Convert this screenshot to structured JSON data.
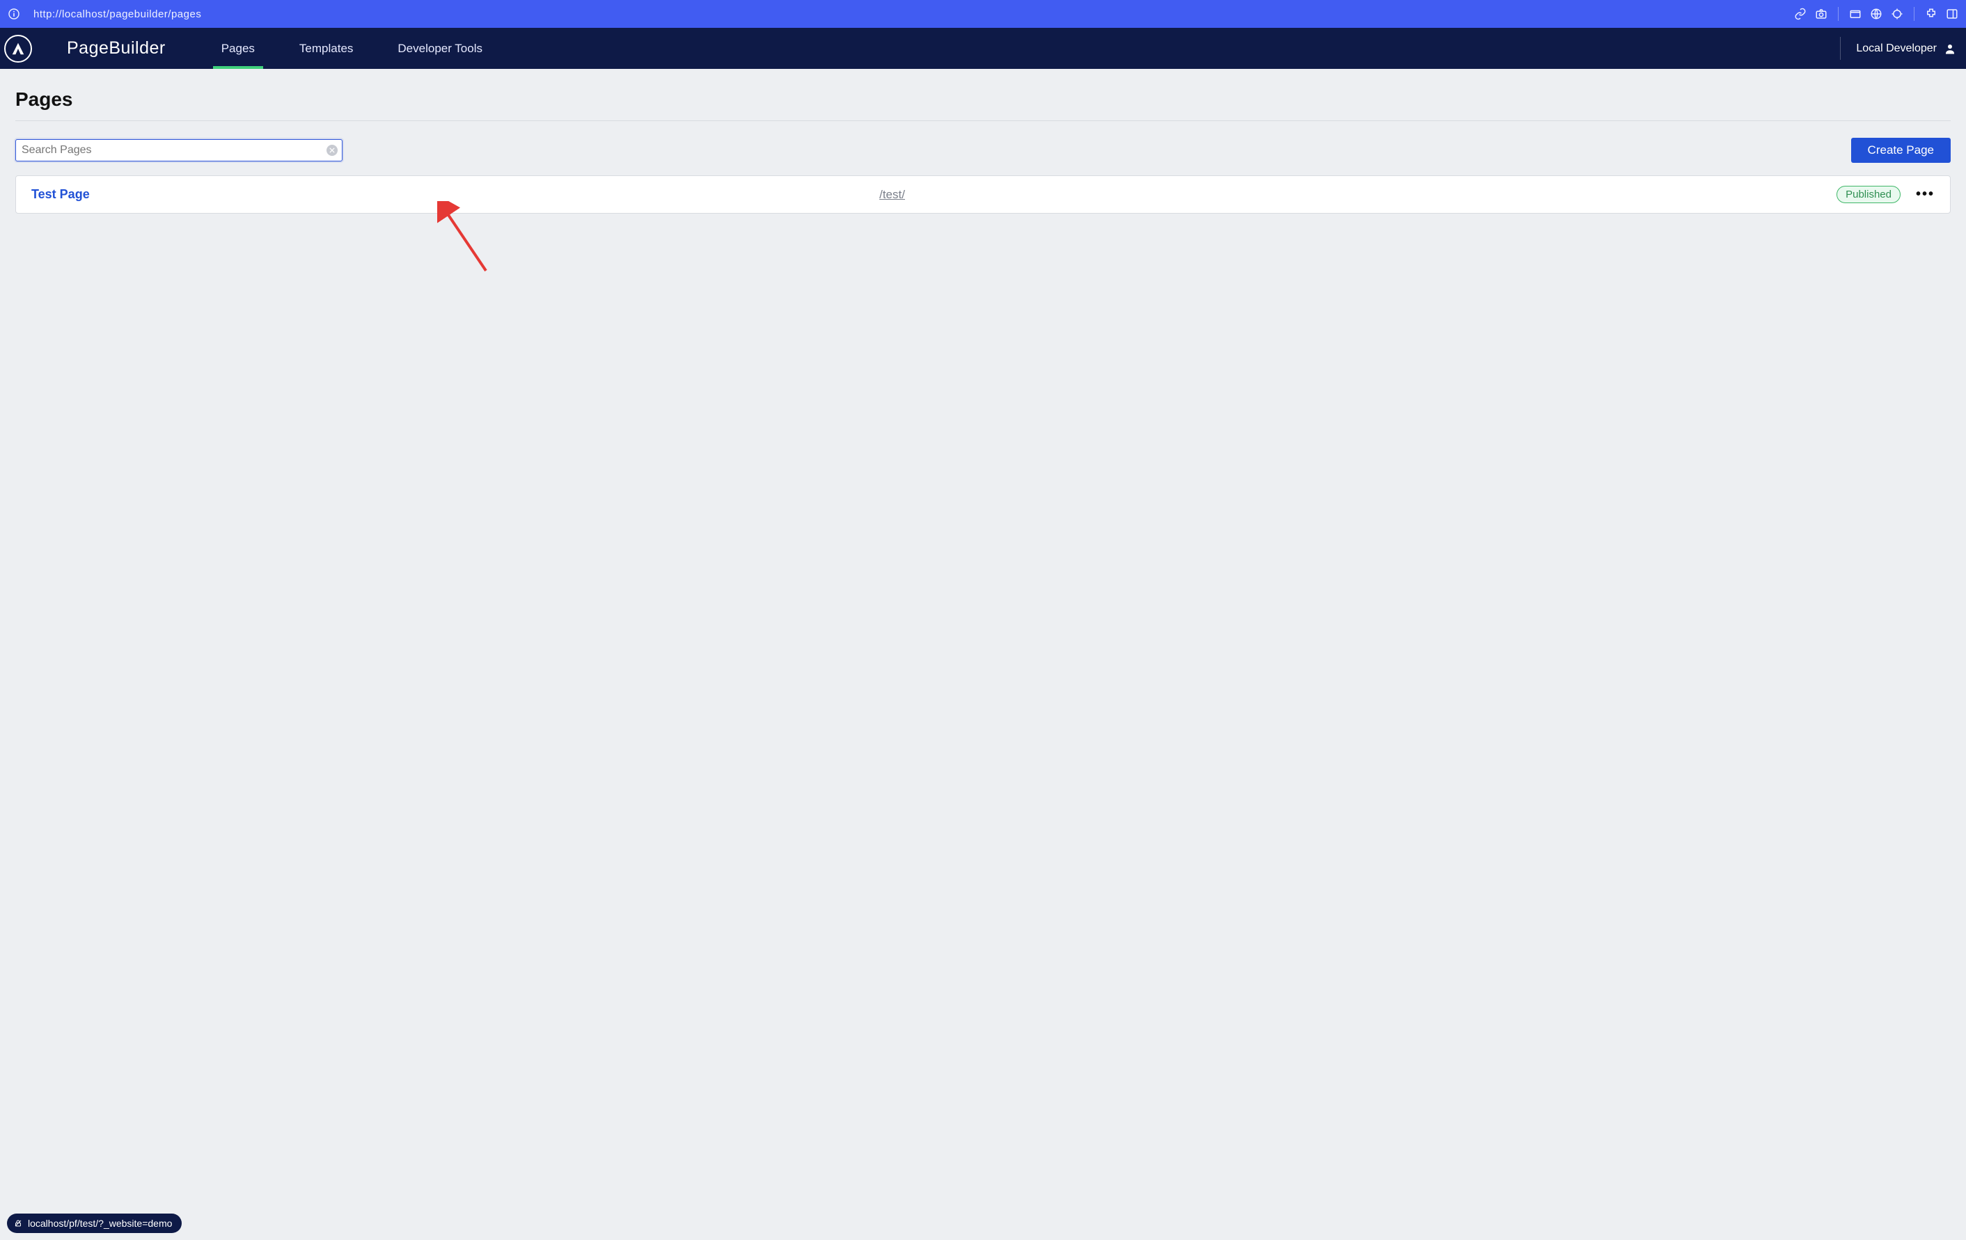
{
  "browser": {
    "url": "http://localhost/pagebuilder/pages",
    "status_text": "localhost/pf/test/?_website=demo"
  },
  "app": {
    "title": "PageBuilder",
    "user_label": "Local Developer",
    "nav": [
      {
        "label": "Pages",
        "active": true
      },
      {
        "label": "Templates",
        "active": false
      },
      {
        "label": "Developer Tools",
        "active": false
      }
    ]
  },
  "page": {
    "heading": "Pages",
    "search_placeholder": "Search Pages",
    "create_button": "Create Page"
  },
  "rows": [
    {
      "title": "Test Page",
      "path": "/test/",
      "status": "Published"
    }
  ]
}
